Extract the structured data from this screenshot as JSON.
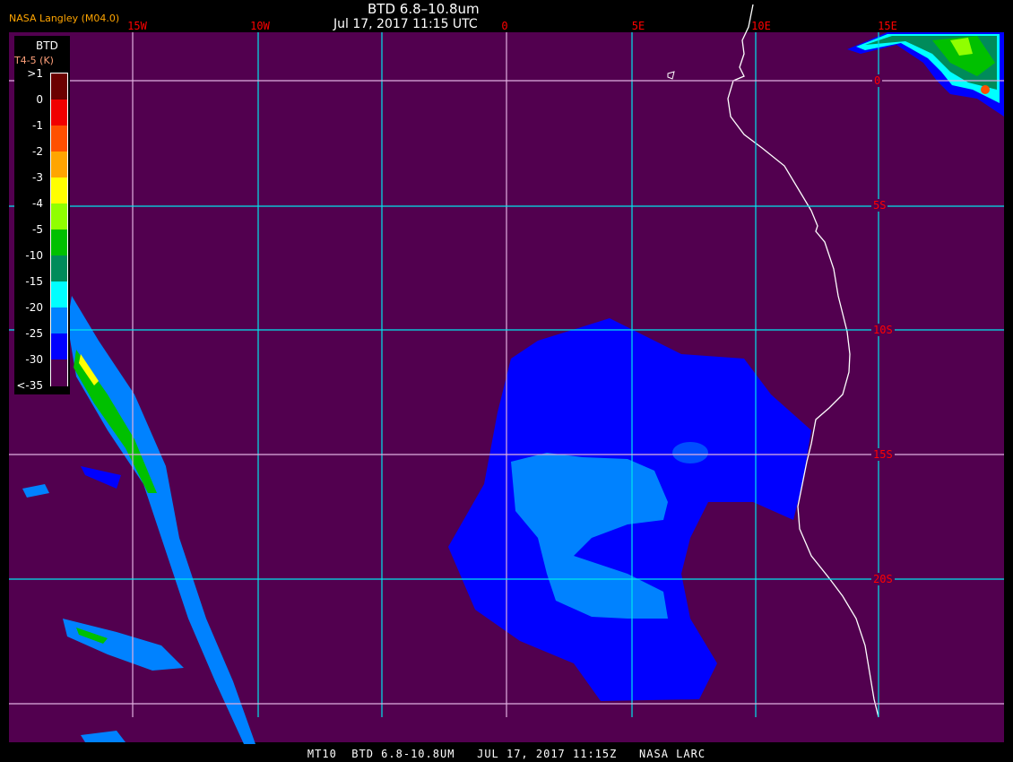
{
  "header": {
    "title": "BTD 6.8–10.8um",
    "datetime": "Jul 17, 2017 11:15 UTC",
    "credit": "NASA Langley (M04.0)"
  },
  "map": {
    "longitude_labels": [
      "15W",
      "10W",
      "5W",
      "0",
      "5E",
      "10E",
      "15E"
    ],
    "latitude_labels": [
      "0",
      "5S",
      "10S",
      "15S",
      "20S"
    ],
    "background_color": "#52004f",
    "grid_color": "#00e5ee",
    "coastline_color": "#ffffff"
  },
  "legend": {
    "title": "BTD",
    "subtitle": "T4-5 (K)",
    "labels": [
      ">1",
      "0",
      "-1",
      "-2",
      "-3",
      "-4",
      "-5",
      "-10",
      "-15",
      "-20",
      "-25",
      "-30",
      "<-35"
    ],
    "colors": [
      "#6b0000",
      "#f00000",
      "#ff5000",
      "#ffa500",
      "#ffff00",
      "#90ff00",
      "#00c000",
      "#008b5a",
      "#00ffff",
      "#0082ff",
      "#0000ff",
      "#52004f"
    ]
  },
  "footer": {
    "text": "MT10  BTD 6.8-10.8UM   JUL 17, 2017 11:15Z   NASA LARC"
  }
}
